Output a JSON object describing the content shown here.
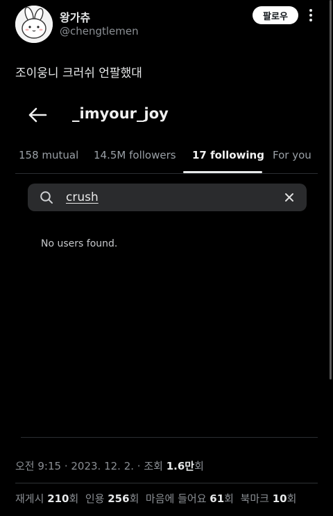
{
  "tweet": {
    "display_name": "왕가츄",
    "handle": "@chengtlemen",
    "follow_label": "팔로우",
    "text": "조이웅니 크러쉬 언팔했대"
  },
  "embedded": {
    "profile_title": "_imyour_joy",
    "tabs": [
      {
        "label": "158 mutual"
      },
      {
        "label": "14.5M followers"
      },
      {
        "label": "17 following"
      },
      {
        "label": "For you"
      }
    ],
    "active_tab": "17 following",
    "search": {
      "value": "crush"
    },
    "empty_message": "No users found."
  },
  "meta": {
    "time": "오전 9:15",
    "date": "2023. 12. 2.",
    "views_label": "조회",
    "views_value": "1.6만",
    "views_suffix": "회"
  },
  "stats": [
    {
      "label": "재게시",
      "value": "210",
      "suffix": "회"
    },
    {
      "label": "인용",
      "value": "256",
      "suffix": "회"
    },
    {
      "label": "마음에 들어요",
      "value": "61",
      "suffix": "회"
    },
    {
      "label": "북마크",
      "value": "10",
      "suffix": "회"
    }
  ],
  "icons": {
    "avatar": "cartoon-bunny-avatar",
    "more": "more-vertical-icon",
    "back": "back-arrow-icon",
    "search": "search-icon",
    "clear": "clear-icon"
  }
}
